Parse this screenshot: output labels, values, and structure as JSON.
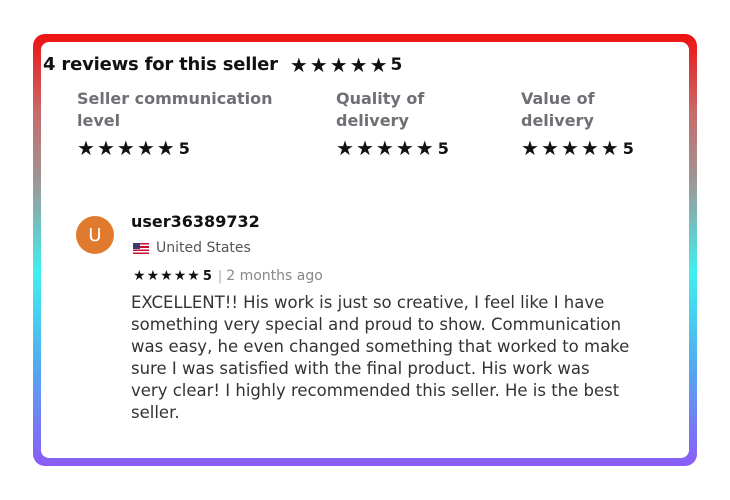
{
  "header": {
    "title": "4 reviews for this seller",
    "overall_rating": "5",
    "overall_stars": 5
  },
  "criteria": [
    {
      "label": "Seller communication level",
      "rating": "5",
      "stars": 5
    },
    {
      "label": "Quality of delivery",
      "rating": "5",
      "stars": 5
    },
    {
      "label": "Value of delivery",
      "rating": "5",
      "stars": 5
    }
  ],
  "review": {
    "avatar_initial": "U",
    "avatar_color": "#e07a2e",
    "username": "user36389732",
    "country": "United States",
    "flag_icon": "us-flag-icon",
    "rating": "5",
    "stars": 5,
    "separator": "|",
    "time_ago": "2 months ago",
    "text": "EXCELLENT!! His work is just so creative, I feel like I have something very special and proud to show. Communication was easy, he even changed something that worked to make sure I was satisfied with the final product. His work was very clear! I highly recommended this seller. He is the best seller."
  },
  "colors": {
    "border_gradient": [
      "#ee1111",
      "#9a9a9a",
      "#3ff0ef",
      "#8b5cf6"
    ],
    "label_gray": "#6f6f75"
  }
}
